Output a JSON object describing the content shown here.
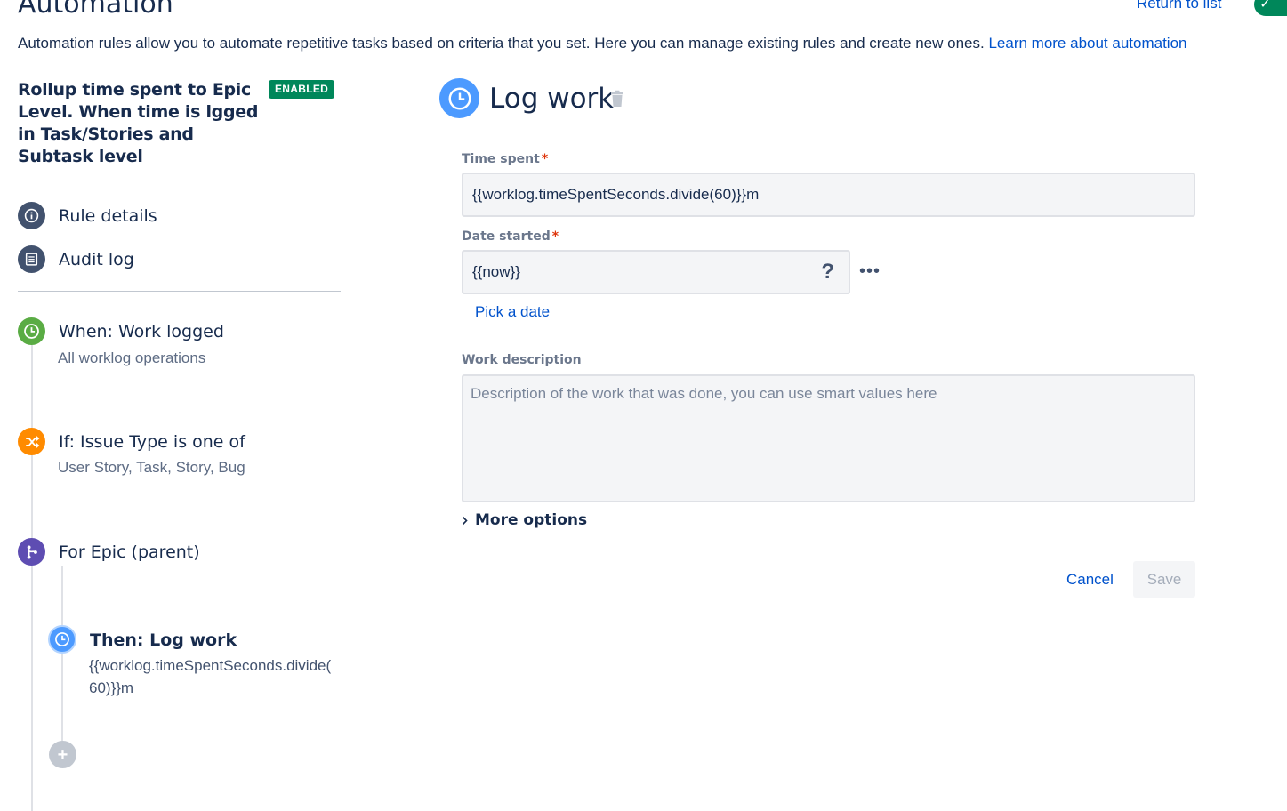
{
  "header": {
    "title": "Automation",
    "return_link": "Return to list",
    "intro_text": "Automation rules allow you to automate repetitive tasks based on criteria that you set. Here you can manage existing rules and create new ones.",
    "learn_more": "Learn more about automation"
  },
  "rule": {
    "title": "Rollup time spent to Epic Level. When time is lgged in Task/Stories and Subtask level",
    "status_badge": "ENABLED"
  },
  "nav": {
    "rule_details": "Rule details",
    "audit_log": "Audit log"
  },
  "steps": {
    "trigger": {
      "title": "When: Work logged",
      "subtitle": "All worklog operations"
    },
    "condition": {
      "title": "If: Issue Type is one of",
      "subtitle": "User Story, Task, Story, Bug"
    },
    "branch": {
      "title": "For Epic (parent)"
    },
    "action": {
      "title": "Then: Log work",
      "subtitle_line1": "{{worklog.timeSpentSeconds.divide(",
      "subtitle_line2": "60)}}m"
    }
  },
  "panel": {
    "title": "Log work",
    "time_spent_label": "Time spent",
    "time_spent_value": "{{worklog.timeSpentSeconds.divide(60)}}m",
    "date_started_label": "Date started",
    "date_started_value": "{{now}}",
    "help_glyph": "?",
    "pick_date": "Pick a date",
    "work_description_label": "Work description",
    "work_description_placeholder": "Description of the work that was done, you can use smart values here",
    "more_options": "More options",
    "cancel": "Cancel",
    "save": "Save"
  },
  "colors": {
    "enabled_green": "#00875a",
    "trigger_green": "#5aac44",
    "condition_orange": "#ff8b00",
    "branch_purple": "#5e4db2",
    "action_blue": "#4c9aff",
    "link_blue": "#0052cc"
  },
  "icons": {
    "info": "info-icon",
    "audit": "list-icon",
    "trigger": "clock-icon",
    "condition": "shuffle-icon",
    "branch": "branch-icon",
    "action": "clock-icon",
    "add": "plus-icon",
    "delete": "trash-icon"
  }
}
